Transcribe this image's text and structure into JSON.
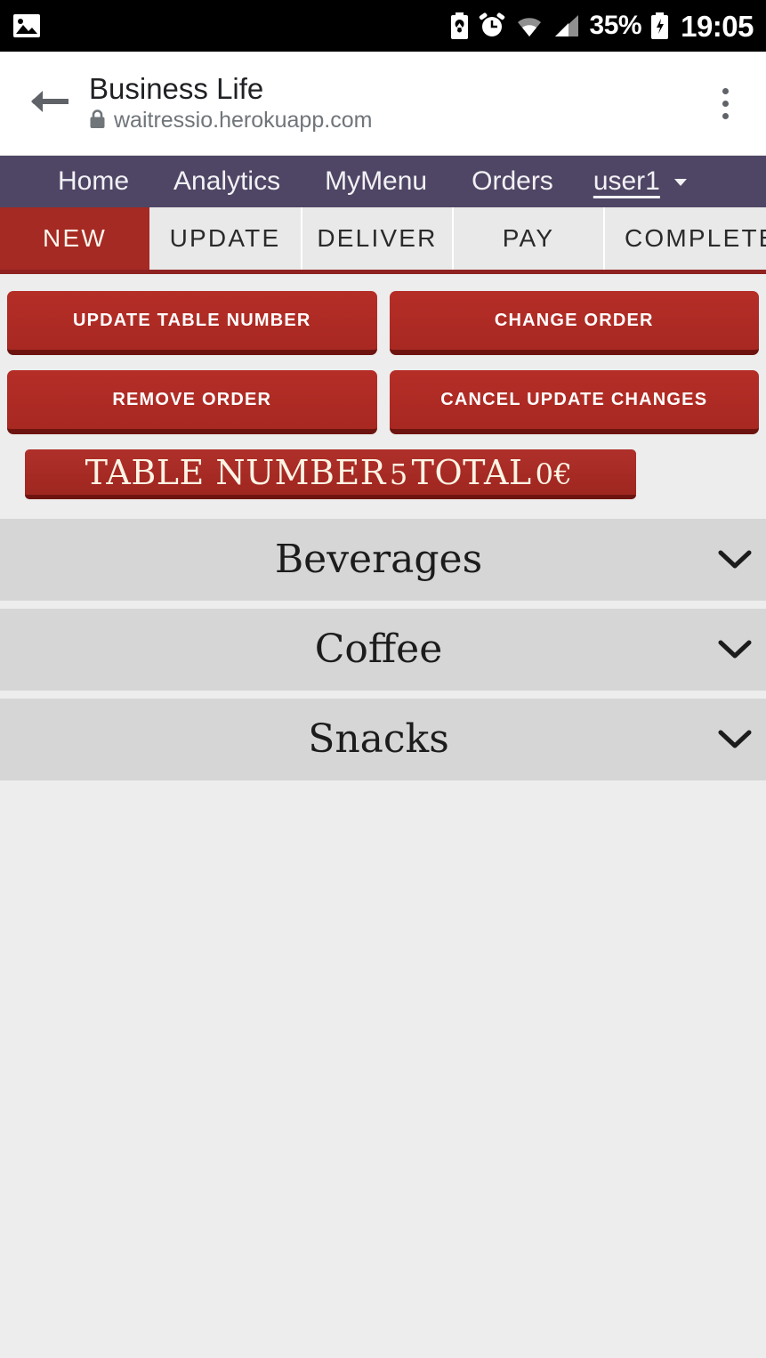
{
  "status_bar": {
    "icons_left": [
      "image-icon"
    ],
    "icons_right": [
      "battery-saver-icon",
      "alarm-icon",
      "wifi-icon",
      "signal-icon"
    ],
    "battery_percent": "35%",
    "battery_icon": "battery-charging-icon",
    "time": "19:05"
  },
  "browser": {
    "back_icon": "back-arrow-icon",
    "title": "Business Life",
    "lock_icon": "lock-icon",
    "url": "waitressio.herokuapp.com",
    "overflow_icon": "overflow-menu-icon"
  },
  "site_nav": {
    "background": "#4f4665",
    "items": [
      {
        "label": "Home"
      },
      {
        "label": "Analytics"
      },
      {
        "label": "MyMenu"
      },
      {
        "label": "Orders"
      }
    ],
    "user": {
      "label": "user1",
      "caret_icon": "caret-down-icon"
    }
  },
  "tabs": {
    "active": "NEW",
    "active_color": "#a52a23",
    "items": [
      {
        "label": "NEW",
        "active": true
      },
      {
        "label": "UPDATE",
        "active": false
      },
      {
        "label": "DELIVER",
        "active": false
      },
      {
        "label": "PAY",
        "active": false
      },
      {
        "label": "COMPLETED",
        "active": false
      }
    ]
  },
  "actions": {
    "accent": "#b02b25",
    "buttons": [
      {
        "label": "UPDATE TABLE NUMBER"
      },
      {
        "label": "CHANGE ORDER"
      },
      {
        "label": "REMOVE ORDER"
      },
      {
        "label": "CANCEL UPDATE CHANGES"
      }
    ]
  },
  "order_banner": {
    "prefix": "TABLE NUMBER",
    "table_number": "5",
    "middle": "TOTAL",
    "total": "0€",
    "full_text": "TABLE NUMBER 5 TOTAL 0€"
  },
  "menu_sections": [
    {
      "title": "Beverages",
      "expanded": false,
      "chevron_icon": "chevron-down-icon"
    },
    {
      "title": "Coffee",
      "expanded": false,
      "chevron_icon": "chevron-down-icon"
    },
    {
      "title": "Snacks",
      "expanded": false,
      "chevron_icon": "chevron-down-icon"
    }
  ]
}
